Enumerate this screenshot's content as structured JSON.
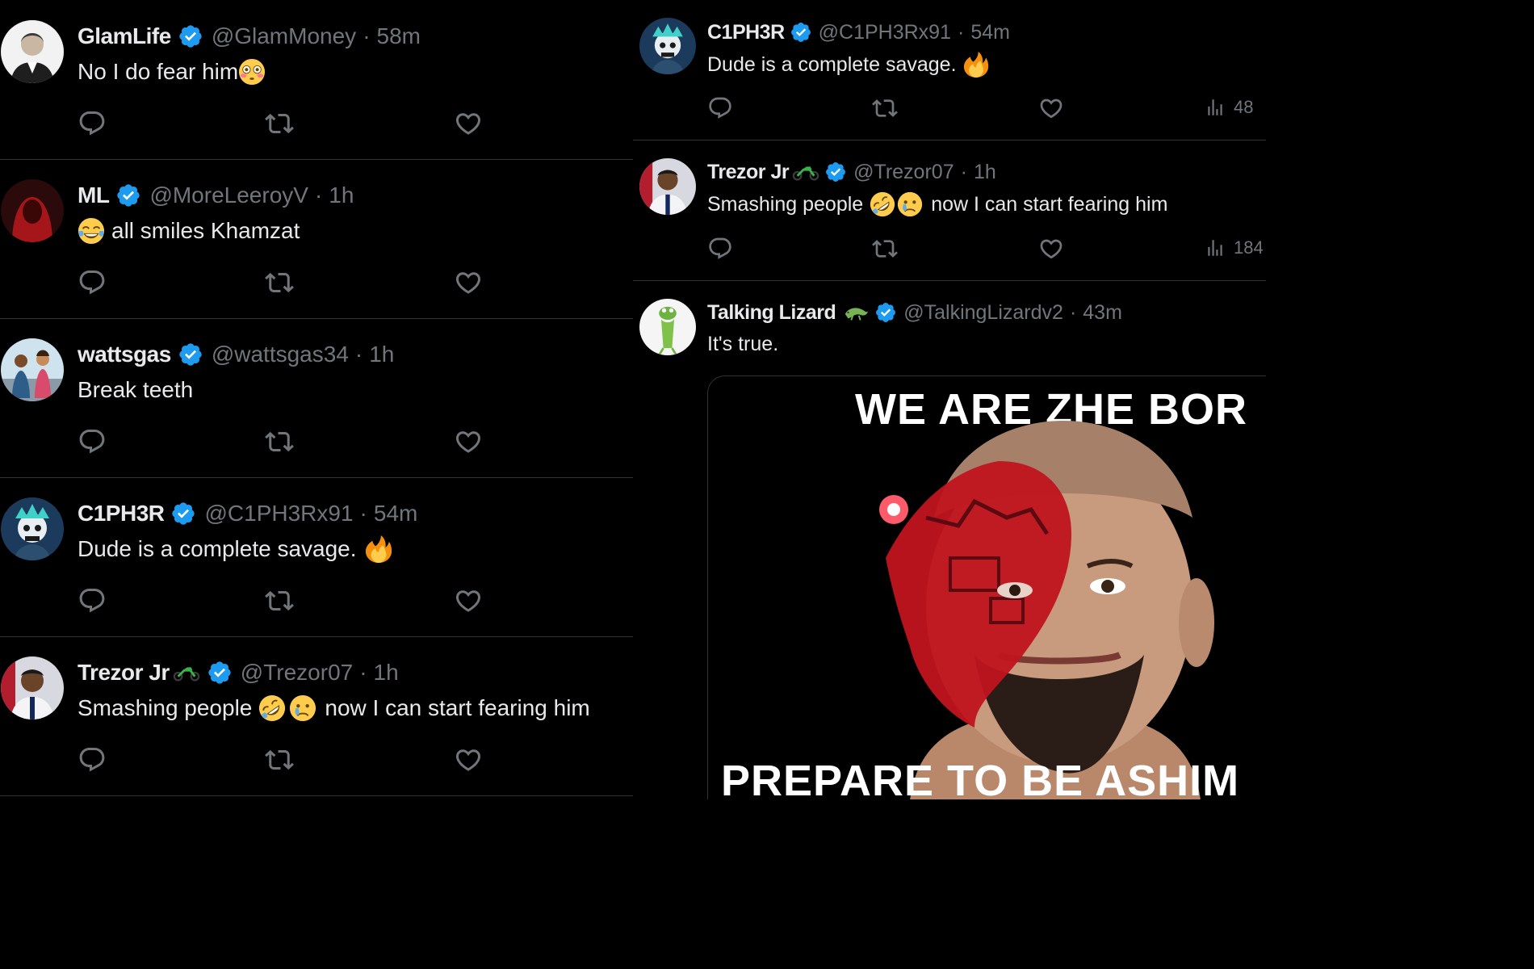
{
  "colors": {
    "background": "#000000",
    "text": "#e7e9ea",
    "muted": "#71767b",
    "verified": "#1d9bf0",
    "divider": "#2f3336"
  },
  "left_column": {
    "tweets": [
      {
        "name": "GlamLife",
        "handle": "@GlamMoney",
        "separator": "·",
        "time": "58m",
        "text": "No I do fear him",
        "emojis": [
          "flushed-face-emoji"
        ]
      },
      {
        "name": "ML",
        "handle": "@MoreLeeroyV",
        "separator": "·",
        "time": "1h",
        "text": "all smiles Khamzat",
        "emojis": [
          "tears-of-joy-emoji"
        ]
      },
      {
        "name": "wattsgas",
        "handle": "@wattsgas34",
        "separator": "·",
        "time": "1h",
        "text": "Break teeth",
        "emojis": []
      },
      {
        "name": "C1PH3R",
        "handle": "@C1PH3Rx91",
        "separator": "·",
        "time": "54m",
        "text": "Dude is a complete savage.",
        "emojis": [
          "fire-emoji"
        ]
      },
      {
        "name": "Trezor Jr",
        "handle": "@Trezor07",
        "separator": "·",
        "time": "1h",
        "text_before": "Smashing people",
        "text_after": "now I can start fearing him",
        "emojis": [
          "rolling-laughing-emoji",
          "crying-face-emoji"
        ]
      }
    ]
  },
  "right_column": {
    "tweets": [
      {
        "name": "C1PH3R",
        "handle": "@C1PH3Rx91",
        "separator": "·",
        "time": "54m",
        "text": "Dude is a complete savage.",
        "views": "48",
        "emojis": [
          "fire-emoji"
        ]
      },
      {
        "name": "Trezor Jr",
        "handle": "@Trezor07",
        "separator": "·",
        "time": "1h",
        "text_before": "Smashing people",
        "text_after": "now I can start fearing him",
        "views": "184",
        "emojis": [
          "rolling-laughing-emoji",
          "crying-face-emoji"
        ]
      },
      {
        "name": "Talking Lizard",
        "handle": "@TalkingLizardv2",
        "separator": "·",
        "time": "43m",
        "text": "It's true.",
        "media": {
          "top_caption": "WE ARE ZHE BOR",
          "bottom_caption": "PREPARE TO BE ASHIM"
        }
      }
    ]
  }
}
